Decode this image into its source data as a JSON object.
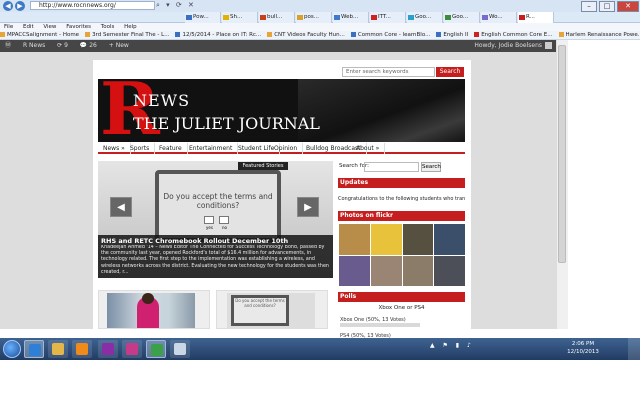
{
  "browser": {
    "url": "http://www.rocnnews.org/",
    "tabs": [
      "Pow...",
      "Sh...",
      "bull...",
      "pos...",
      "Web...",
      "ITT...",
      "Goo...",
      "Goo...",
      "Wo...",
      "R..."
    ],
    "tab_colors": [
      "#3a6fc2",
      "#e1b200",
      "#c5401b",
      "#d8a12a",
      "#3d7bd0",
      "#c22",
      "#29a0c9",
      "#3b8e3b",
      "#7a6ad0",
      "#c51e1e"
    ],
    "menu": [
      "File",
      "Edit",
      "View",
      "Favorites",
      "Tools",
      "Help"
    ],
    "favorites": [
      {
        "label": "MPACCSalignment - Home",
        "color": "#e8a33a"
      },
      {
        "label": "3rd Semester Final The - L...",
        "color": "#e8a33a"
      },
      {
        "label": "12/5/2014 - Place on IT: Rc...",
        "color": "#3a6fc2"
      },
      {
        "label": "CNT Videos Faculty Hun...",
        "color": "#e8a33a"
      },
      {
        "label": "Common Core - learnBlo...",
        "color": "#3a6fc2"
      },
      {
        "label": "English II",
        "color": "#3a6fc2"
      },
      {
        "label": "English Common Core E...",
        "color": "#c22"
      },
      {
        "label": "Harlem Renaissance Powe...",
        "color": "#e8a33a"
      }
    ]
  },
  "adminbar": {
    "items": [
      "R News",
      "9",
      "26",
      "New"
    ],
    "user": "Howdy, Jodie Boelsens"
  },
  "site": {
    "search_placeholder": "Enter search keywords",
    "search_button": "Search",
    "banner_letter": "R",
    "banner_news": "NEWS",
    "banner_subtitle": "THE JULIET JOURNAL",
    "nav": [
      "News »",
      "Sports",
      "Feature",
      "Entertainment",
      "Student Life",
      "Opinion",
      "Bulldog Broadcast",
      "About »"
    ]
  },
  "slider": {
    "tag": "Featured Stories",
    "screen_question": "Do you accept the terms and conditions?",
    "screen_yes": "yes",
    "screen_no": "no",
    "caption_title": "RHS and RETC Chromebook Rollout December 10th",
    "caption_body": "Khadeejah Ahmed '14 – News Editor The Connected for Success Technology Bond, passed by the community last year, opened Rockford's total of $16.4 million for advancements, in technology related. The first step to the implementation was establishing a wireless, and wireless networks across the district. Evaluating the new technology for the students was then created, r..."
  },
  "sidebar": {
    "search_label": "Search for:",
    "search_button": "Search",
    "updates_title": "Updates",
    "updates_text": "Congratulations to the following students who tran",
    "photos_title": "Photos on flickr",
    "photo_colors": [
      "#b88d4a",
      "#e7c23a",
      "#55503f",
      "#3b4f6b",
      "#6a5b8f",
      "#9a8574",
      "#8b7c6a",
      "#4c4f57"
    ],
    "polls_title": "Polls",
    "poll_question": "Xbox One or PS4",
    "poll_option_a": "Xbox One (50%, 13 Votes)",
    "poll_option_b": "PS4 (50%, 13 Votes)"
  },
  "taskbar": {
    "apps": [
      {
        "name": "ie",
        "color": "#2f7fd6"
      },
      {
        "name": "explorer",
        "color": "#e3b64a"
      },
      {
        "name": "media",
        "color": "#f08a1a"
      },
      {
        "name": "onenote",
        "color": "#8a2ea8"
      },
      {
        "name": "paint",
        "color": "#c63a8a"
      },
      {
        "name": "chrome",
        "color": "#3aa14a"
      },
      {
        "name": "misc",
        "color": "#c9d7e6"
      }
    ],
    "time": "2:06 PM",
    "date": "12/10/2013"
  }
}
